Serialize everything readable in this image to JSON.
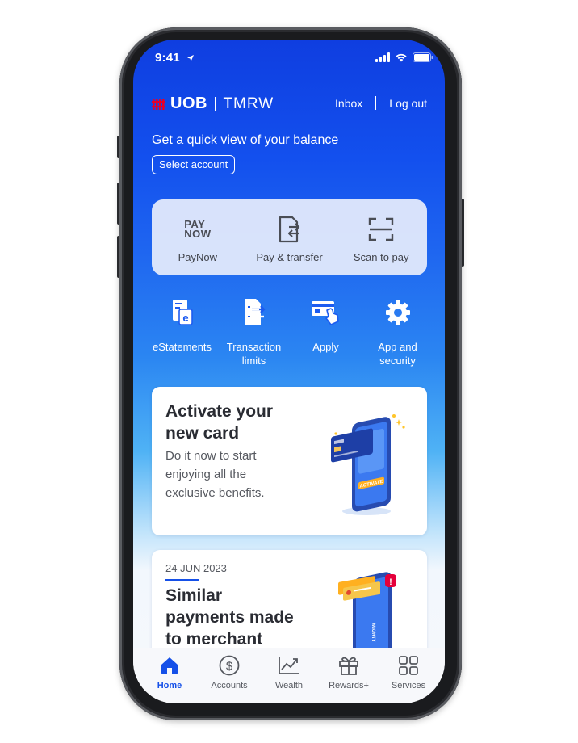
{
  "status_bar": {
    "time": "9:41"
  },
  "header": {
    "logo_text": "UOB",
    "logo_sub": "TMRW",
    "inbox_label": "Inbox",
    "logout_label": "Log out"
  },
  "balance": {
    "title": "Get a quick view of your balance",
    "select_account_label": "Select account"
  },
  "quick_actions": [
    {
      "label": "PayNow",
      "icon": "paynow-icon",
      "logo_line1": "PAY",
      "logo_line2": "NOW"
    },
    {
      "label": "Pay & transfer",
      "icon": "pay-transfer-icon"
    },
    {
      "label": "Scan to pay",
      "icon": "scan-icon"
    }
  ],
  "shortcuts": [
    {
      "label": "eStatements",
      "icon": "estatement-icon"
    },
    {
      "label": "Transaction\nlimits",
      "icon": "transaction-limits-icon"
    },
    {
      "label": "Apply",
      "icon": "apply-card-icon"
    },
    {
      "label": "App and\nsecurity",
      "icon": "gear-icon"
    }
  ],
  "promos": [
    {
      "title": "Activate your\nnew card",
      "body": "Do it now to start\nenjoying all the\nexclusive benefits.",
      "art_label": "ACTIVATE"
    },
    {
      "date": "24 JUN 2023",
      "title": "Similar\npayments made\nto merchant",
      "art_label": "MIGHTY"
    }
  ],
  "bottom_nav": [
    {
      "label": "Home",
      "icon": "home-icon",
      "active": true
    },
    {
      "label": "Accounts",
      "icon": "dollar-icon",
      "active": false
    },
    {
      "label": "Wealth",
      "icon": "chart-icon",
      "active": false
    },
    {
      "label": "Rewards+",
      "icon": "gift-icon",
      "active": false
    },
    {
      "label": "Services",
      "icon": "grid-icon",
      "active": false
    }
  ],
  "colors": {
    "brand_blue": "#1550e8",
    "logo_red": "#e4002b",
    "text_dark": "#2a2c33"
  }
}
